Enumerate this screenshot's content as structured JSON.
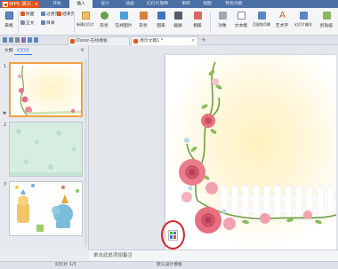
{
  "titlebar": {
    "app_button": "WPS 演示",
    "tabs": [
      "开始",
      "插入",
      "设计",
      "动画",
      "幻灯片放映",
      "审阅",
      "视图",
      "特色功能"
    ],
    "active_tab": "插入"
  },
  "ribbon": {
    "table": "表格",
    "new_slide": "新建幻灯片",
    "shapes": "形状",
    "clipart": "剪贴画",
    "online_picture": "在线图片",
    "smartart": "形状",
    "chart": "图表",
    "screenshot": "截屏",
    "album": "相册",
    "textbox": "文本框",
    "header_footer": "页眉和页脚",
    "wordart": "艺术字",
    "slide_number": "幻灯片编号",
    "object": "对象",
    "picture": "图片",
    "small": [
      "封面",
      "过渡页",
      "结束页",
      "正文",
      "目录",
      "艺术字"
    ]
  },
  "docbar": {
    "tabs": [
      {
        "label": "Docer-在线模板",
        "active": false
      },
      {
        "label": "演示文稿1 *",
        "active": true
      }
    ],
    "new_tab": "+"
  },
  "leftpane": {
    "tabs": [
      "大纲",
      "幻灯片"
    ],
    "active_tab": "幻灯片",
    "close": "×",
    "slides": [
      {
        "number": "1",
        "selected": true,
        "theme": "roses"
      },
      {
        "number": "2",
        "selected": false,
        "theme": "green"
      },
      {
        "number": "3",
        "selected": false,
        "theme": "cartoon"
      }
    ]
  },
  "notes": {
    "placeholder": "单击此处添加备注"
  },
  "statusbar": {
    "slide_info": "幻灯片 1/3",
    "theme": "默认设计模板"
  },
  "colors": {
    "titlebar": "#4a6fa5",
    "app_orange": "#e2571e",
    "selected_thumb": "#f0a040",
    "annotation": "#d12a2a"
  }
}
